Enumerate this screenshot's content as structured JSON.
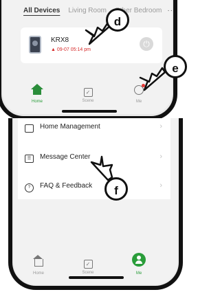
{
  "top_screen": {
    "tabs": [
      "All Devices",
      "Living Room",
      "Other Bedroom"
    ],
    "tabs_more": "···",
    "device": {
      "name": "KRX8",
      "status": "09-07 05:14 pm"
    },
    "nav": [
      {
        "label": "Home",
        "active": true
      },
      {
        "label": "Scene",
        "active": false
      },
      {
        "label": "Me",
        "active": false,
        "badge": true
      }
    ]
  },
  "bottom_screen": {
    "menu": [
      {
        "label": "Home Management",
        "icon": "home-management-icon"
      },
      {
        "label": "Message Center",
        "icon": "message-icon"
      },
      {
        "label": "FAQ & Feedback",
        "icon": "question-icon"
      }
    ],
    "nav": [
      {
        "label": "Home",
        "active": false
      },
      {
        "label": "Scene",
        "active": false
      },
      {
        "label": "Me",
        "active": true
      }
    ]
  },
  "callouts": {
    "d": "d",
    "e": "e",
    "f": "f"
  },
  "colors": {
    "accent_green": "#2a9d3a",
    "status_red": "#d62828",
    "badge_red": "#e53935"
  }
}
